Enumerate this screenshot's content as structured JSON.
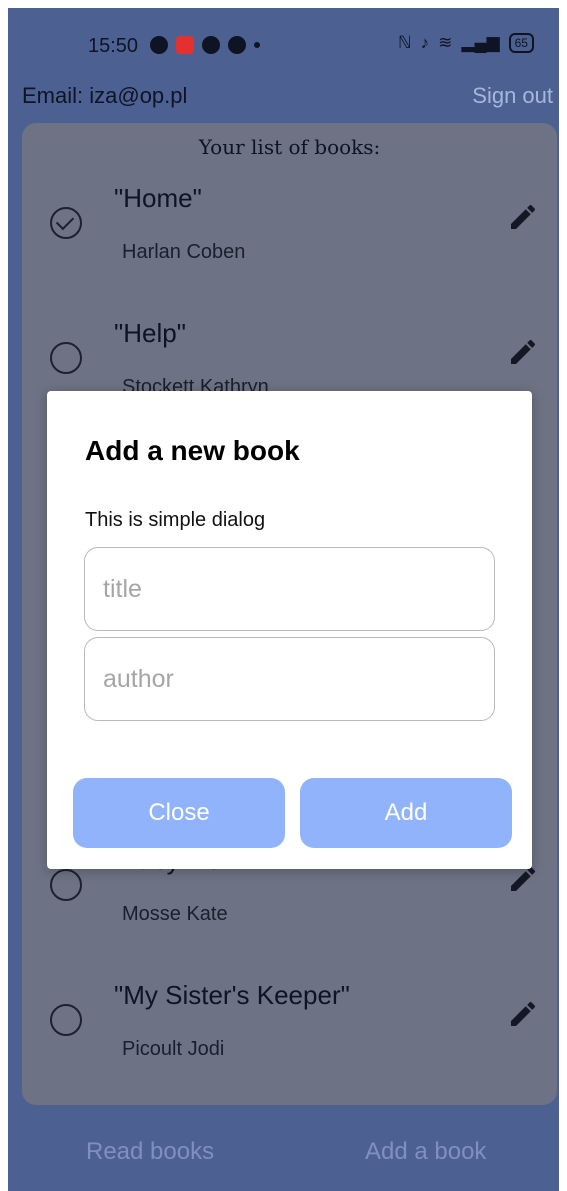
{
  "status_bar": {
    "time": "15:50",
    "battery": "65"
  },
  "header": {
    "email": "Email: iza@op.pl",
    "sign_out": "Sign out"
  },
  "list": {
    "title": "Your list of books:",
    "books": [
      {
        "title": "\"Home\"",
        "author": "Harlan Coben",
        "read": true
      },
      {
        "title": "\"Help\"",
        "author": "Stockett Kathryn",
        "read": false
      },
      {
        "title": "\"Labyrinth\"",
        "author": "Mosse Kate",
        "read": false
      },
      {
        "title": "\"My Sister's Keeper\"",
        "author": "Picoult Jodi",
        "read": false
      }
    ]
  },
  "dialog": {
    "title": "Add a new book",
    "description": "This is simple dialog",
    "title_placeholder": "title",
    "author_placeholder": "author",
    "close_label": "Close",
    "add_label": "Add"
  },
  "bottom_nav": {
    "read_books": "Read books",
    "add_book": "Add a book"
  },
  "colors": {
    "background": "#4c6192",
    "card": "#6d7384",
    "button": "#90b3fb",
    "sign_out": "#a5b6e3"
  }
}
